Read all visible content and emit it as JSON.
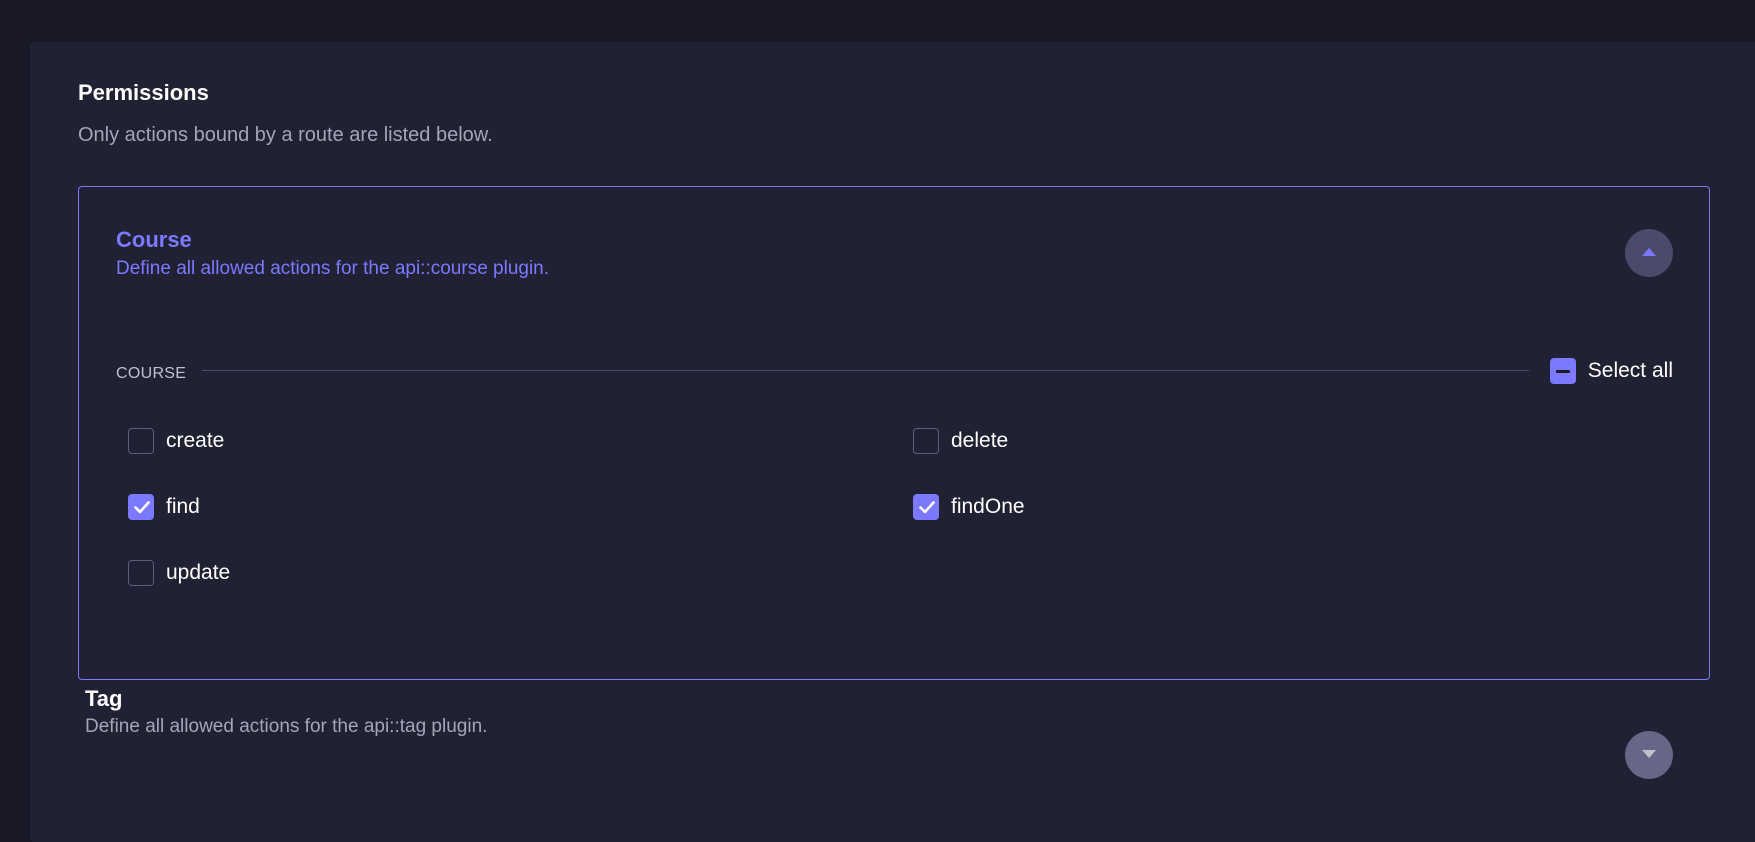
{
  "permissions": {
    "title": "Permissions",
    "subtitle": "Only actions bound by a route are listed below."
  },
  "course": {
    "title": "Course",
    "description": "Define all allowed actions for the api::course plugin.",
    "expanded": true,
    "section_label": "COURSE",
    "select_all_label": "Select all",
    "select_all_state": "indeterminate",
    "actions": [
      {
        "label": "create",
        "checked": false
      },
      {
        "label": "delete",
        "checked": false
      },
      {
        "label": "find",
        "checked": true
      },
      {
        "label": "findOne",
        "checked": true
      },
      {
        "label": "update",
        "checked": false
      }
    ]
  },
  "tag": {
    "title": "Tag",
    "description": "Define all allowed actions for the api::tag plugin.",
    "expanded": false
  },
  "colors": {
    "accent": "#7b79ff",
    "background": "#181826",
    "panel": "#212134",
    "muted_text": "#a5a5ba"
  },
  "icons": {
    "expand_toggle_open": "caret-up-icon",
    "expand_toggle_closed": "caret-down-icon",
    "checkmark": "check-icon",
    "indeterminate": "minus-icon"
  }
}
